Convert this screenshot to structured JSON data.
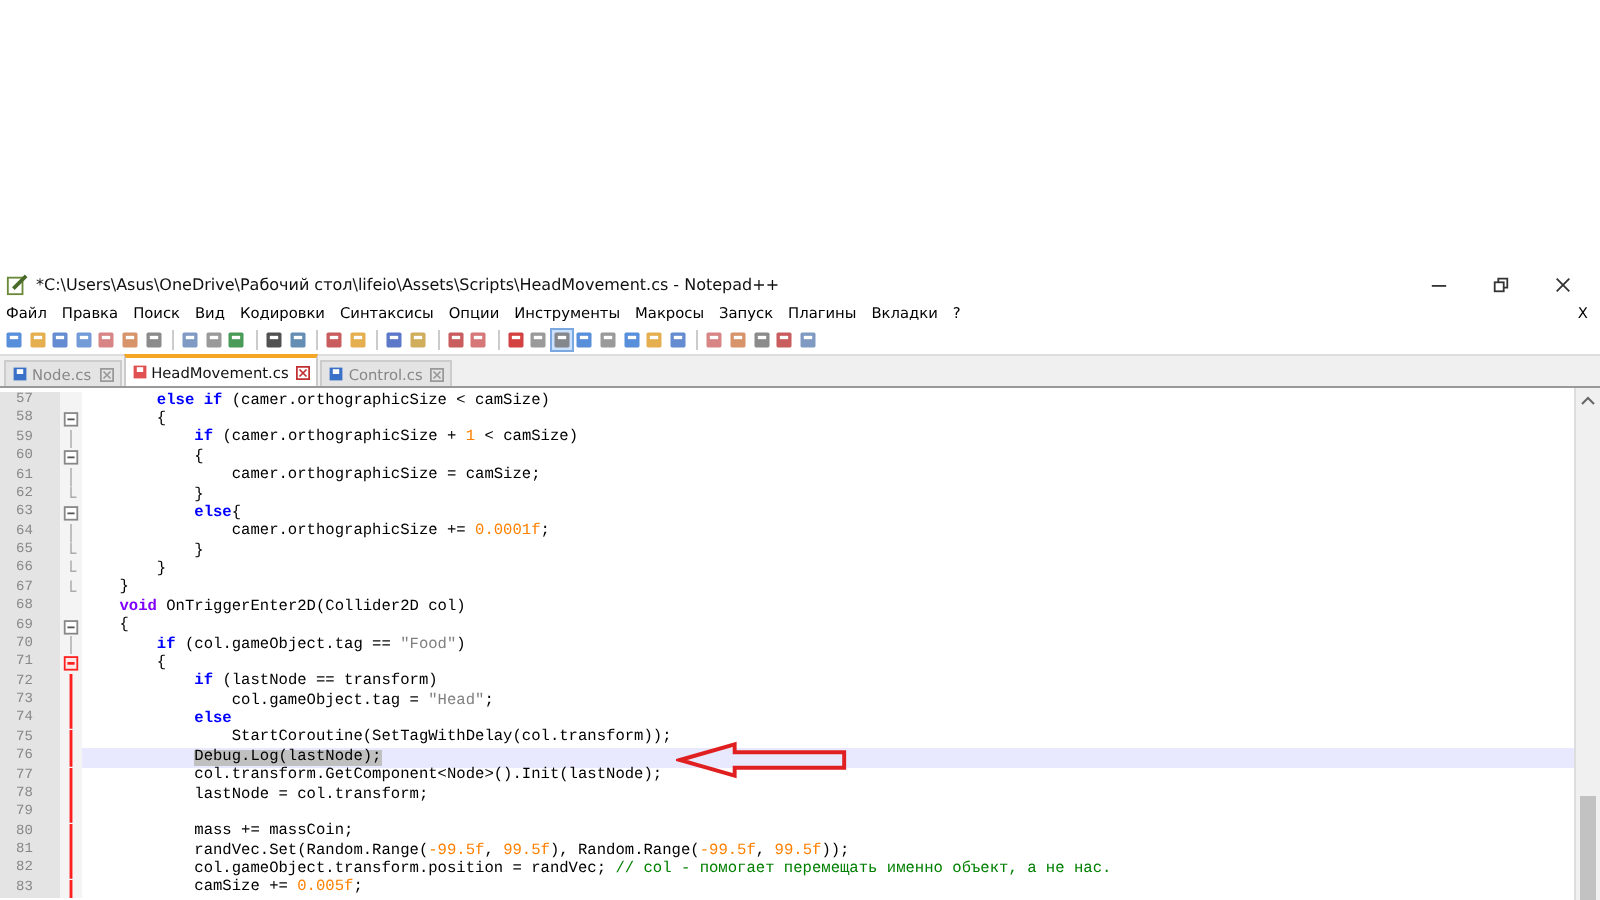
{
  "window": {
    "title": "*C:\\Users\\Asus\\OneDrive\\Рабочий стол\\lifeio\\Assets\\Scripts\\HeadMovement.cs - Notepad++"
  },
  "menu": [
    "Файл",
    "Правка",
    "Поиск",
    "Вид",
    "Кодировки",
    "Синтаксисы",
    "Опции",
    "Инструменты",
    "Макросы",
    "Запуск",
    "Плагины",
    "Вкладки",
    "?"
  ],
  "menu_close": "X",
  "tabs": [
    {
      "label": "Node.cs",
      "selected": false
    },
    {
      "label": "HeadMovement.cs",
      "selected": true
    },
    {
      "label": "Control.cs",
      "selected": false
    }
  ],
  "editor": {
    "lines": [
      {
        "number": "57",
        "kind": "plain",
        "active": false,
        "current": false,
        "tokens": [
          {
            "kind": "keyword",
            "text": "        else if"
          },
          {
            "kind": "plain",
            "text": " (camer.orthographicSize < camSize)"
          }
        ]
      },
      {
        "number": "58",
        "kind": "fold_start",
        "active": false,
        "current": false,
        "tokens": [
          {
            "kind": "plain",
            "text": "        {"
          }
        ]
      },
      {
        "number": "59",
        "kind": "fold_body",
        "active": false,
        "current": false,
        "tokens": [
          {
            "kind": "keyword",
            "text": "            if"
          },
          {
            "kind": "plain",
            "text": " (camer.orthographicSize + "
          },
          {
            "kind": "number",
            "text": "1"
          },
          {
            "kind": "plain",
            "text": " < camSize)"
          }
        ]
      },
      {
        "number": "60",
        "kind": "fold_start",
        "active": false,
        "current": false,
        "tokens": [
          {
            "kind": "plain",
            "text": "            {"
          }
        ]
      },
      {
        "number": "61",
        "kind": "fold_body",
        "active": false,
        "current": false,
        "tokens": [
          {
            "kind": "plain",
            "text": "                camer.orthographicSize = camSize;"
          }
        ]
      },
      {
        "number": "62",
        "kind": "fold_end",
        "active": false,
        "current": false,
        "tokens": [
          {
            "kind": "plain",
            "text": "            }"
          }
        ]
      },
      {
        "number": "63",
        "kind": "fold_start",
        "active": false,
        "current": false,
        "tokens": [
          {
            "kind": "keyword",
            "text": "            else"
          },
          {
            "kind": "plain",
            "text": "{"
          }
        ]
      },
      {
        "number": "64",
        "kind": "fold_body",
        "active": false,
        "current": false,
        "tokens": [
          {
            "kind": "plain",
            "text": "                camer.orthographicSize += "
          },
          {
            "kind": "number",
            "text": "0.0001f"
          },
          {
            "kind": "plain",
            "text": ";"
          }
        ]
      },
      {
        "number": "65",
        "kind": "fold_end",
        "active": false,
        "current": false,
        "tokens": [
          {
            "kind": "plain",
            "text": "            }"
          }
        ]
      },
      {
        "number": "66",
        "kind": "fold_end",
        "active": false,
        "current": false,
        "tokens": [
          {
            "kind": "plain",
            "text": "        }"
          }
        ]
      },
      {
        "number": "67",
        "kind": "fold_end",
        "active": false,
        "current": false,
        "tokens": [
          {
            "kind": "plain",
            "text": "    }"
          }
        ]
      },
      {
        "number": "68",
        "kind": "plain",
        "active": false,
        "current": false,
        "tokens": [
          {
            "kind": "type",
            "text": "    void"
          },
          {
            "kind": "plain",
            "text": " OnTriggerEnter2D(Collider2D col)"
          }
        ]
      },
      {
        "number": "69",
        "kind": "fold_start",
        "active": false,
        "current": false,
        "tokens": [
          {
            "kind": "plain",
            "text": "    {"
          }
        ]
      },
      {
        "number": "70",
        "kind": "fold_body",
        "active": false,
        "current": false,
        "tokens": [
          {
            "kind": "keyword",
            "text": "        if"
          },
          {
            "kind": "plain",
            "text": " (col.gameObject.tag == "
          },
          {
            "kind": "string",
            "text": "\"Food\""
          },
          {
            "kind": "plain",
            "text": ")"
          }
        ]
      },
      {
        "number": "71",
        "kind": "fold_start",
        "active": true,
        "current": false,
        "tokens": [
          {
            "kind": "plain",
            "text": "        {"
          }
        ]
      },
      {
        "number": "72",
        "kind": "fold_body",
        "active": true,
        "current": false,
        "tokens": [
          {
            "kind": "keyword",
            "text": "            if"
          },
          {
            "kind": "plain",
            "text": " (lastNode == transform)"
          }
        ]
      },
      {
        "number": "73",
        "kind": "fold_body",
        "active": true,
        "current": false,
        "tokens": [
          {
            "kind": "plain",
            "text": "                col.gameObject.tag = "
          },
          {
            "kind": "string",
            "text": "\"Head\""
          },
          {
            "kind": "plain",
            "text": ";"
          }
        ]
      },
      {
        "number": "74",
        "kind": "fold_body",
        "active": true,
        "current": false,
        "tokens": [
          {
            "kind": "keyword",
            "text": "            else"
          }
        ]
      },
      {
        "number": "75",
        "kind": "fold_body",
        "active": true,
        "current": false,
        "tokens": [
          {
            "kind": "plain",
            "text": "                StartCoroutine(SetTagWithDelay(col.transform));"
          }
        ]
      },
      {
        "number": "76",
        "kind": "fold_body",
        "active": true,
        "current": true,
        "tokens": [
          {
            "kind": "selected",
            "text": "            Debug.Log(lastNode);"
          }
        ]
      },
      {
        "number": "77",
        "kind": "fold_body",
        "active": true,
        "current": false,
        "tokens": [
          {
            "kind": "plain",
            "text": "            col.transform.GetComponent<Node>().Init(lastNode);"
          }
        ]
      },
      {
        "number": "78",
        "kind": "fold_body",
        "active": true,
        "current": false,
        "tokens": [
          {
            "kind": "plain",
            "text": "            lastNode = col.transform;"
          }
        ]
      },
      {
        "number": "79",
        "kind": "fold_body",
        "active": true,
        "current": false
      },
      {
        "number": "80",
        "kind": "fold_body",
        "active": true,
        "current": false,
        "tokens": [
          {
            "kind": "plain",
            "text": "            mass += massCoin;"
          }
        ]
      },
      {
        "number": "81",
        "kind": "fold_body",
        "active": true,
        "current": false,
        "tokens": [
          {
            "kind": "plain",
            "text": "            randVec.Set(Random.Range("
          },
          {
            "kind": "number",
            "text": "-99.5f"
          },
          {
            "kind": "plain",
            "text": ", "
          },
          {
            "kind": "number",
            "text": "99.5f"
          },
          {
            "kind": "plain",
            "text": "), Random.Range("
          },
          {
            "kind": "number",
            "text": "-99.5f"
          },
          {
            "kind": "plain",
            "text": ", "
          },
          {
            "kind": "number",
            "text": "99.5f"
          },
          {
            "kind": "plain",
            "text": "));"
          }
        ]
      },
      {
        "number": "82",
        "kind": "fold_body",
        "active": true,
        "current": false,
        "tokens": [
          {
            "kind": "plain",
            "text": "            col.gameObject.transform.position = randVec; "
          },
          {
            "kind": "comment",
            "text": "// col - помогает перемещать именно объект, а не нас."
          }
        ]
      },
      {
        "number": "83",
        "kind": "fold_body",
        "active": true,
        "current": false,
        "tokens": [
          {
            "kind": "plain",
            "text": "            camSize += "
          },
          {
            "kind": "number",
            "text": "0.005f"
          },
          {
            "kind": "plain",
            "text": ";"
          }
        ]
      }
    ]
  }
}
